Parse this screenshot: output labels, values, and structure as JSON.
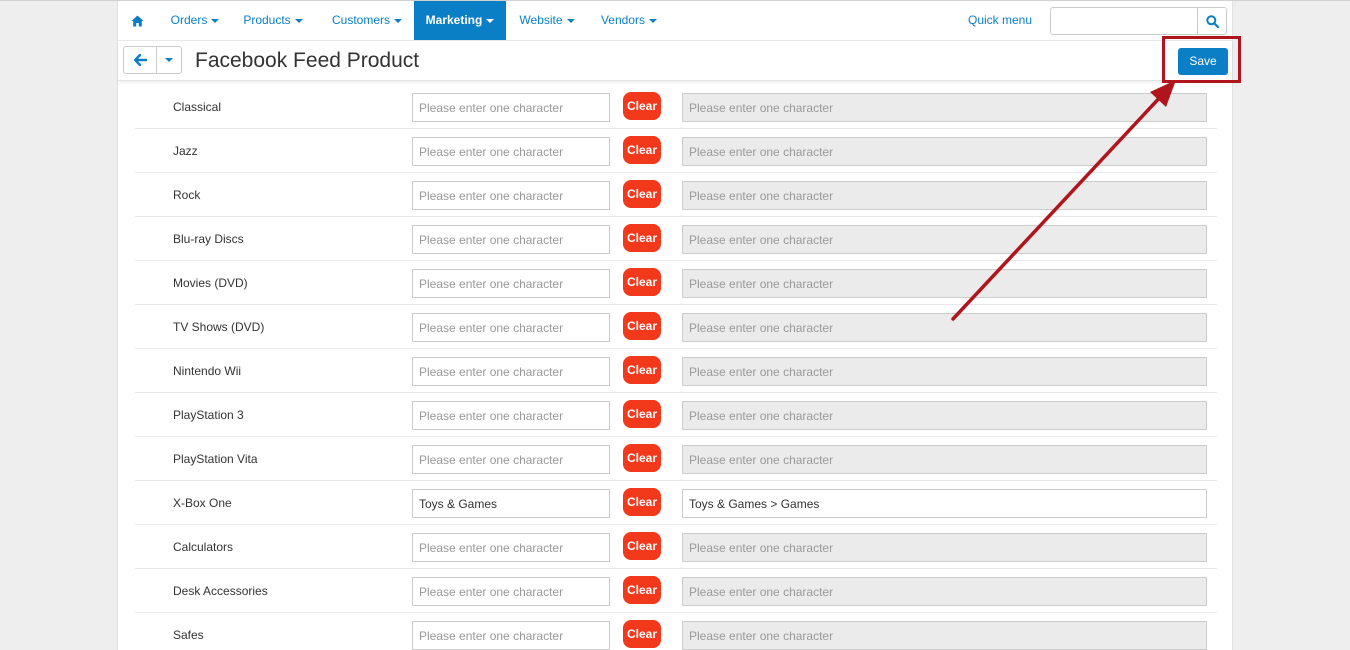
{
  "nav": {
    "items": [
      {
        "label": "Orders"
      },
      {
        "label": "Products"
      },
      {
        "label": "Customers"
      },
      {
        "label": "Marketing"
      },
      {
        "label": "Website"
      },
      {
        "label": "Vendors"
      }
    ],
    "active": "Marketing",
    "quick_menu": "Quick menu",
    "search_value": "",
    "accent_color": "#0b7fc6"
  },
  "header": {
    "title": "Facebook Feed Product",
    "save_label": "Save"
  },
  "table": {
    "placeholder": "Please enter one character",
    "clear_label": "Clear",
    "clear_color": "#f2391b",
    "rows": [
      {
        "label": "Classical",
        "left_value": "",
        "right_value": ""
      },
      {
        "label": "Jazz",
        "left_value": "",
        "right_value": ""
      },
      {
        "label": "Rock",
        "left_value": "",
        "right_value": ""
      },
      {
        "label": "Blu-ray Discs",
        "left_value": "",
        "right_value": ""
      },
      {
        "label": "Movies (DVD)",
        "left_value": "",
        "right_value": ""
      },
      {
        "label": "TV Shows (DVD)",
        "left_value": "",
        "right_value": ""
      },
      {
        "label": "Nintendo Wii",
        "left_value": "",
        "right_value": ""
      },
      {
        "label": "PlayStation 3",
        "left_value": "",
        "right_value": ""
      },
      {
        "label": "PlayStation Vita",
        "left_value": "",
        "right_value": ""
      },
      {
        "label": "X-Box One",
        "left_value": "Toys & Games",
        "right_value": "Toys & Games > Games"
      },
      {
        "label": "Calculators",
        "left_value": "",
        "right_value": ""
      },
      {
        "label": "Desk Accessories",
        "left_value": "",
        "right_value": ""
      },
      {
        "label": "Safes",
        "left_value": "",
        "right_value": ""
      }
    ]
  },
  "annotation": {
    "color": "#b0141c"
  }
}
